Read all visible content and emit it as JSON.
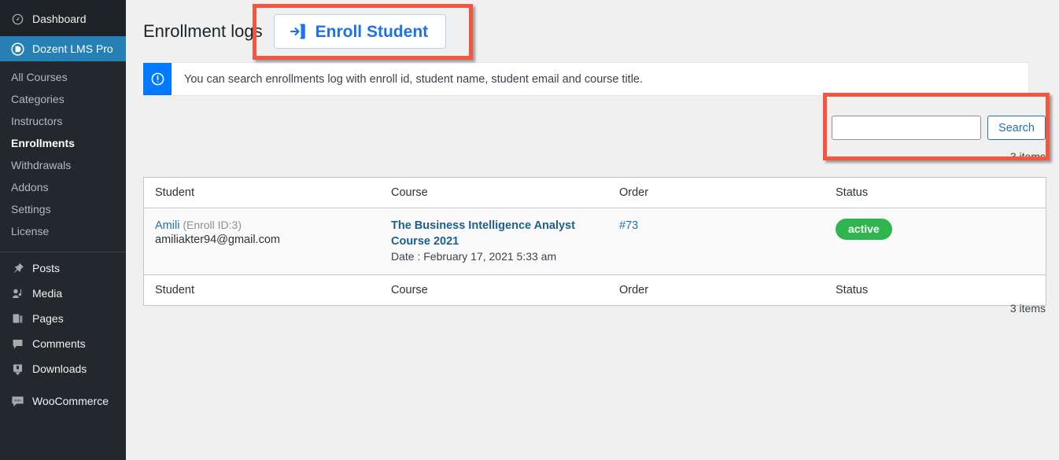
{
  "sidebar": {
    "top_items": [
      {
        "label": "Dashboard",
        "icon": "dashboard-gauge-icon"
      }
    ],
    "current_item": {
      "label": "Dozent LMS Pro",
      "icon": "dozent-logo-icon"
    },
    "submenu": [
      {
        "label": "All Courses",
        "active": false
      },
      {
        "label": "Categories",
        "active": false
      },
      {
        "label": "Instructors",
        "active": false
      },
      {
        "label": "Enrollments",
        "active": true
      },
      {
        "label": "Withdrawals",
        "active": false
      },
      {
        "label": "Addons",
        "active": false
      },
      {
        "label": "Settings",
        "active": false
      },
      {
        "label": "License",
        "active": false
      }
    ],
    "bottom_items": [
      {
        "label": "Posts",
        "icon": "pin-icon"
      },
      {
        "label": "Media",
        "icon": "media-icon"
      },
      {
        "label": "Pages",
        "icon": "pages-icon"
      },
      {
        "label": "Comments",
        "icon": "comment-bubble-icon"
      },
      {
        "label": "Downloads",
        "icon": "download-icon"
      },
      {
        "label": "WooCommerce",
        "icon": "woocommerce-icon"
      }
    ]
  },
  "header": {
    "title": "Enrollment logs",
    "enroll_button_label": "Enroll Student",
    "enroll_button_icon": "enroll-door-arrow-icon"
  },
  "notice": {
    "icon": "exclamation-circle-icon",
    "text": "You can search enrollments log with enroll id, student name, student email and course title."
  },
  "search": {
    "value": "",
    "placeholder": "",
    "button_label": "Search"
  },
  "items_count_top": "3 items",
  "items_count_bottom": "3 items",
  "table": {
    "columns": [
      "Student",
      "Course",
      "Order",
      "Status"
    ],
    "rows": [
      {
        "student_name": "Amili",
        "enroll_id": "(Enroll ID:3)",
        "student_email": "amiliakter94@gmail.com",
        "course_title": "The Business Intelligence Analyst Course 2021",
        "course_date": "Date : February 17, 2021 5:33 am",
        "order": "#73",
        "status": "active"
      }
    ]
  },
  "colors": {
    "accent_blue": "#2271b1",
    "link_blue": "#1d72e8",
    "notice_blue": "#007bff",
    "status_green": "#2eb54d",
    "annotation_red": "#f4563f",
    "sidebar_dark": "#23282d",
    "sidebar_current": "#2680b5"
  }
}
